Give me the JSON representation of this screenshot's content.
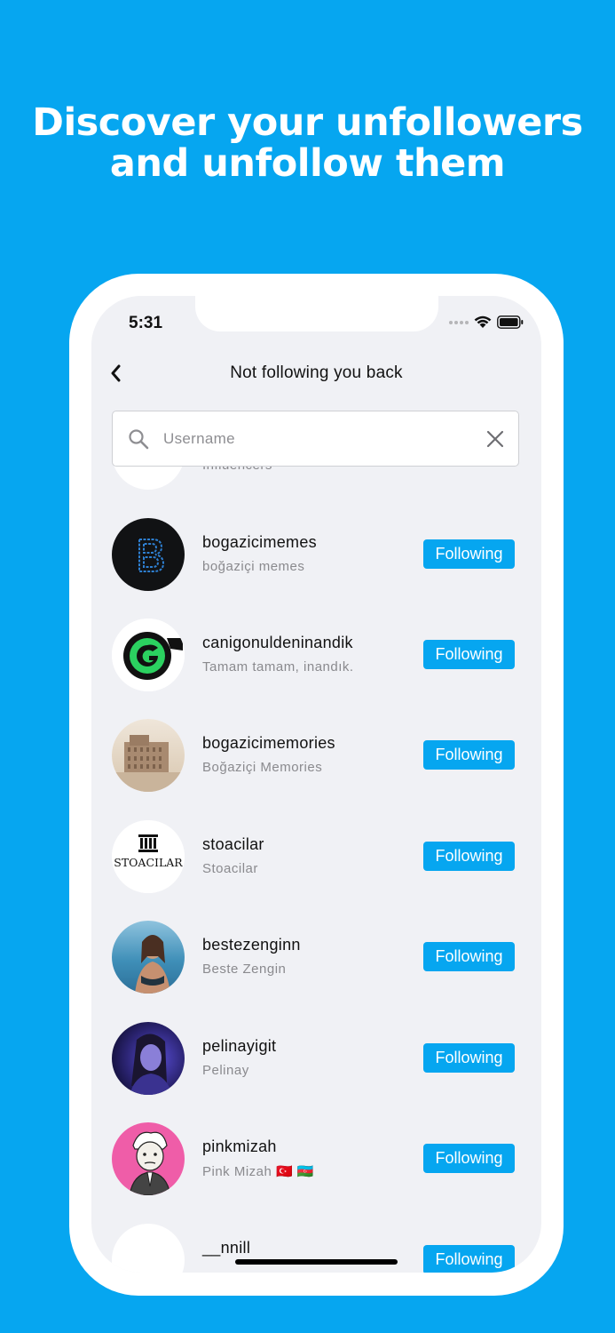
{
  "headline": {
    "line1": "Discover your unfollowers",
    "line2": "and unfollow them"
  },
  "status_bar": {
    "time": "5:31"
  },
  "nav": {
    "title": "Not following you back"
  },
  "search": {
    "placeholder": "Username"
  },
  "list": {
    "partial_top_subtitle": "Influencers",
    "button_label": "Following",
    "items": [
      {
        "username": "bogazicimemes",
        "full_name": "boğaziçi memes"
      },
      {
        "username": "canigonuldeninandik",
        "full_name": "Tamam tamam, inandık."
      },
      {
        "username": "bogazicimemories",
        "full_name": "Boğaziçi Memories"
      },
      {
        "username": "stoacilar",
        "full_name": "Stoacilar"
      },
      {
        "username": "bestezenginn",
        "full_name": "Beste Zengin"
      },
      {
        "username": "pelinayigit",
        "full_name": "Pelinay"
      },
      {
        "username": "pinkmizah",
        "full_name": "Pink Mizah 🇹🇷 🇦🇿"
      },
      {
        "username": "__nnill",
        "full_name": ""
      }
    ]
  },
  "avatar_logo_text": {
    "stoacilar": "STOACILAR"
  },
  "colors": {
    "brand_blue": "#06a6f0",
    "screen_bg": "#f0f1f5"
  },
  "icons": {
    "back": "chevron-left-icon",
    "search": "search-icon",
    "clear": "close-icon",
    "wifi": "wifi-icon",
    "battery": "battery-icon"
  }
}
